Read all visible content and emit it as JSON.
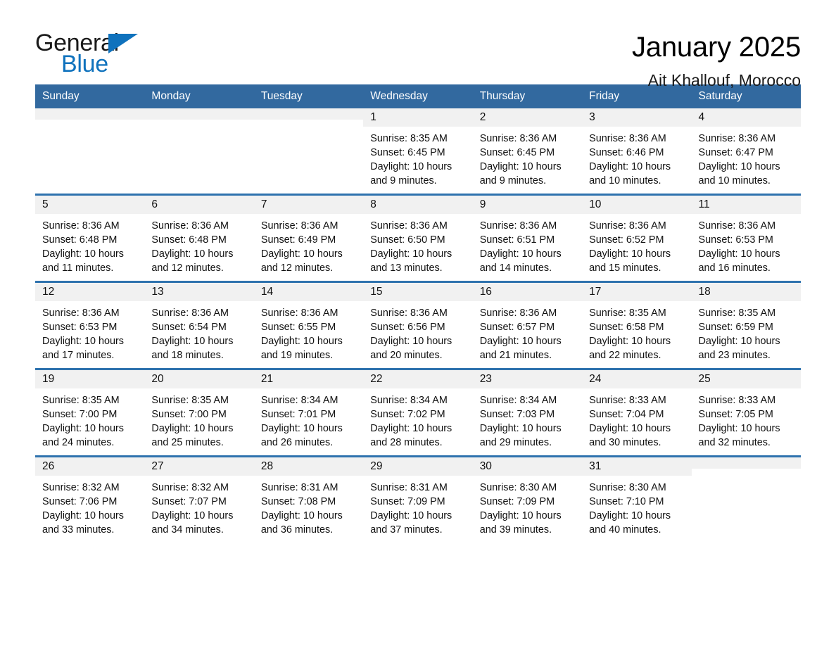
{
  "brand": {
    "name_top": "General",
    "name_bottom": "Blue",
    "flag_icon": "triangle-flag-icon",
    "accent_color": "#0f72bd"
  },
  "header": {
    "title": "January 2025",
    "location": "Ait Khallouf, Morocco"
  },
  "colors": {
    "header_blue": "#32699f",
    "row_divider_blue": "#2e72ae",
    "daynum_band": "#f1f1f1",
    "text": "#111111"
  },
  "calendar": {
    "weekday_headers": [
      "Sunday",
      "Monday",
      "Tuesday",
      "Wednesday",
      "Thursday",
      "Friday",
      "Saturday"
    ],
    "weeks": [
      [
        {
          "day": "",
          "empty": true,
          "sunrise": "",
          "sunset": "",
          "daylight_line1": "",
          "daylight_line2": ""
        },
        {
          "day": "",
          "empty": true,
          "sunrise": "",
          "sunset": "",
          "daylight_line1": "",
          "daylight_line2": ""
        },
        {
          "day": "",
          "empty": true,
          "sunrise": "",
          "sunset": "",
          "daylight_line1": "",
          "daylight_line2": ""
        },
        {
          "day": "1",
          "empty": false,
          "sunrise": "Sunrise: 8:35 AM",
          "sunset": "Sunset: 6:45 PM",
          "daylight_line1": "Daylight: 10 hours",
          "daylight_line2": "and 9 minutes."
        },
        {
          "day": "2",
          "empty": false,
          "sunrise": "Sunrise: 8:36 AM",
          "sunset": "Sunset: 6:45 PM",
          "daylight_line1": "Daylight: 10 hours",
          "daylight_line2": "and 9 minutes."
        },
        {
          "day": "3",
          "empty": false,
          "sunrise": "Sunrise: 8:36 AM",
          "sunset": "Sunset: 6:46 PM",
          "daylight_line1": "Daylight: 10 hours",
          "daylight_line2": "and 10 minutes."
        },
        {
          "day": "4",
          "empty": false,
          "sunrise": "Sunrise: 8:36 AM",
          "sunset": "Sunset: 6:47 PM",
          "daylight_line1": "Daylight: 10 hours",
          "daylight_line2": "and 10 minutes."
        }
      ],
      [
        {
          "day": "5",
          "empty": false,
          "sunrise": "Sunrise: 8:36 AM",
          "sunset": "Sunset: 6:48 PM",
          "daylight_line1": "Daylight: 10 hours",
          "daylight_line2": "and 11 minutes."
        },
        {
          "day": "6",
          "empty": false,
          "sunrise": "Sunrise: 8:36 AM",
          "sunset": "Sunset: 6:48 PM",
          "daylight_line1": "Daylight: 10 hours",
          "daylight_line2": "and 12 minutes."
        },
        {
          "day": "7",
          "empty": false,
          "sunrise": "Sunrise: 8:36 AM",
          "sunset": "Sunset: 6:49 PM",
          "daylight_line1": "Daylight: 10 hours",
          "daylight_line2": "and 12 minutes."
        },
        {
          "day": "8",
          "empty": false,
          "sunrise": "Sunrise: 8:36 AM",
          "sunset": "Sunset: 6:50 PM",
          "daylight_line1": "Daylight: 10 hours",
          "daylight_line2": "and 13 minutes."
        },
        {
          "day": "9",
          "empty": false,
          "sunrise": "Sunrise: 8:36 AM",
          "sunset": "Sunset: 6:51 PM",
          "daylight_line1": "Daylight: 10 hours",
          "daylight_line2": "and 14 minutes."
        },
        {
          "day": "10",
          "empty": false,
          "sunrise": "Sunrise: 8:36 AM",
          "sunset": "Sunset: 6:52 PM",
          "daylight_line1": "Daylight: 10 hours",
          "daylight_line2": "and 15 minutes."
        },
        {
          "day": "11",
          "empty": false,
          "sunrise": "Sunrise: 8:36 AM",
          "sunset": "Sunset: 6:53 PM",
          "daylight_line1": "Daylight: 10 hours",
          "daylight_line2": "and 16 minutes."
        }
      ],
      [
        {
          "day": "12",
          "empty": false,
          "sunrise": "Sunrise: 8:36 AM",
          "sunset": "Sunset: 6:53 PM",
          "daylight_line1": "Daylight: 10 hours",
          "daylight_line2": "and 17 minutes."
        },
        {
          "day": "13",
          "empty": false,
          "sunrise": "Sunrise: 8:36 AM",
          "sunset": "Sunset: 6:54 PM",
          "daylight_line1": "Daylight: 10 hours",
          "daylight_line2": "and 18 minutes."
        },
        {
          "day": "14",
          "empty": false,
          "sunrise": "Sunrise: 8:36 AM",
          "sunset": "Sunset: 6:55 PM",
          "daylight_line1": "Daylight: 10 hours",
          "daylight_line2": "and 19 minutes."
        },
        {
          "day": "15",
          "empty": false,
          "sunrise": "Sunrise: 8:36 AM",
          "sunset": "Sunset: 6:56 PM",
          "daylight_line1": "Daylight: 10 hours",
          "daylight_line2": "and 20 minutes."
        },
        {
          "day": "16",
          "empty": false,
          "sunrise": "Sunrise: 8:36 AM",
          "sunset": "Sunset: 6:57 PM",
          "daylight_line1": "Daylight: 10 hours",
          "daylight_line2": "and 21 minutes."
        },
        {
          "day": "17",
          "empty": false,
          "sunrise": "Sunrise: 8:35 AM",
          "sunset": "Sunset: 6:58 PM",
          "daylight_line1": "Daylight: 10 hours",
          "daylight_line2": "and 22 minutes."
        },
        {
          "day": "18",
          "empty": false,
          "sunrise": "Sunrise: 8:35 AM",
          "sunset": "Sunset: 6:59 PM",
          "daylight_line1": "Daylight: 10 hours",
          "daylight_line2": "and 23 minutes."
        }
      ],
      [
        {
          "day": "19",
          "empty": false,
          "sunrise": "Sunrise: 8:35 AM",
          "sunset": "Sunset: 7:00 PM",
          "daylight_line1": "Daylight: 10 hours",
          "daylight_line2": "and 24 minutes."
        },
        {
          "day": "20",
          "empty": false,
          "sunrise": "Sunrise: 8:35 AM",
          "sunset": "Sunset: 7:00 PM",
          "daylight_line1": "Daylight: 10 hours",
          "daylight_line2": "and 25 minutes."
        },
        {
          "day": "21",
          "empty": false,
          "sunrise": "Sunrise: 8:34 AM",
          "sunset": "Sunset: 7:01 PM",
          "daylight_line1": "Daylight: 10 hours",
          "daylight_line2": "and 26 minutes."
        },
        {
          "day": "22",
          "empty": false,
          "sunrise": "Sunrise: 8:34 AM",
          "sunset": "Sunset: 7:02 PM",
          "daylight_line1": "Daylight: 10 hours",
          "daylight_line2": "and 28 minutes."
        },
        {
          "day": "23",
          "empty": false,
          "sunrise": "Sunrise: 8:34 AM",
          "sunset": "Sunset: 7:03 PM",
          "daylight_line1": "Daylight: 10 hours",
          "daylight_line2": "and 29 minutes."
        },
        {
          "day": "24",
          "empty": false,
          "sunrise": "Sunrise: 8:33 AM",
          "sunset": "Sunset: 7:04 PM",
          "daylight_line1": "Daylight: 10 hours",
          "daylight_line2": "and 30 minutes."
        },
        {
          "day": "25",
          "empty": false,
          "sunrise": "Sunrise: 8:33 AM",
          "sunset": "Sunset: 7:05 PM",
          "daylight_line1": "Daylight: 10 hours",
          "daylight_line2": "and 32 minutes."
        }
      ],
      [
        {
          "day": "26",
          "empty": false,
          "sunrise": "Sunrise: 8:32 AM",
          "sunset": "Sunset: 7:06 PM",
          "daylight_line1": "Daylight: 10 hours",
          "daylight_line2": "and 33 minutes."
        },
        {
          "day": "27",
          "empty": false,
          "sunrise": "Sunrise: 8:32 AM",
          "sunset": "Sunset: 7:07 PM",
          "daylight_line1": "Daylight: 10 hours",
          "daylight_line2": "and 34 minutes."
        },
        {
          "day": "28",
          "empty": false,
          "sunrise": "Sunrise: 8:31 AM",
          "sunset": "Sunset: 7:08 PM",
          "daylight_line1": "Daylight: 10 hours",
          "daylight_line2": "and 36 minutes."
        },
        {
          "day": "29",
          "empty": false,
          "sunrise": "Sunrise: 8:31 AM",
          "sunset": "Sunset: 7:09 PM",
          "daylight_line1": "Daylight: 10 hours",
          "daylight_line2": "and 37 minutes."
        },
        {
          "day": "30",
          "empty": false,
          "sunrise": "Sunrise: 8:30 AM",
          "sunset": "Sunset: 7:09 PM",
          "daylight_line1": "Daylight: 10 hours",
          "daylight_line2": "and 39 minutes."
        },
        {
          "day": "31",
          "empty": false,
          "sunrise": "Sunrise: 8:30 AM",
          "sunset": "Sunset: 7:10 PM",
          "daylight_line1": "Daylight: 10 hours",
          "daylight_line2": "and 40 minutes."
        },
        {
          "day": "",
          "empty": true,
          "sunrise": "",
          "sunset": "",
          "daylight_line1": "",
          "daylight_line2": ""
        }
      ]
    ]
  }
}
